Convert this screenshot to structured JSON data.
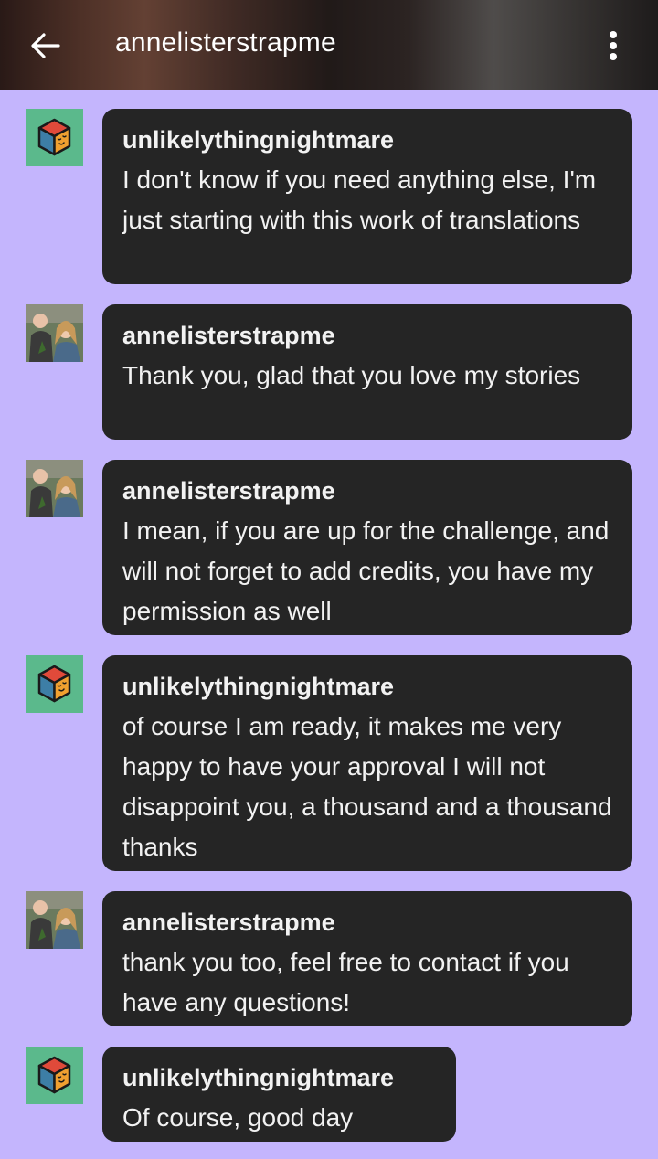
{
  "header": {
    "title": "annelisterstrapme",
    "back_icon": "arrow-left-icon",
    "menu_icon": "more-vertical-icon"
  },
  "messages": [
    {
      "sender": "unlikelythingnightmare",
      "avatar": "cube-avatar",
      "text": "I don't know if you need anything else, I'm just starting with this work of translations"
    },
    {
      "sender": "annelisterstrapme",
      "avatar": "photo-avatar",
      "text": "Thank you, glad that you love my stories"
    },
    {
      "sender": "annelisterstrapme",
      "avatar": "photo-avatar",
      "text": "I mean, if you are up for the challenge, and will not forget to add credits, you have my permission as well"
    },
    {
      "sender": "unlikelythingnightmare",
      "avatar": "cube-avatar",
      "text": "of course I am ready, it makes me very happy to have your approval I will not disappoint you, a thousand and a thousand thanks"
    },
    {
      "sender": "annelisterstrapme",
      "avatar": "photo-avatar",
      "text": "thank you too, feel free to contact if you have any questions!"
    },
    {
      "sender": "unlikelythingnightmare",
      "avatar": "cube-avatar",
      "text": "Of course, good day"
    }
  ],
  "colors": {
    "background": "#c4b5fd",
    "bubble": "#252525",
    "cube_avatar_bg": "#5bb98c",
    "cube_blue": "#3d7ea6",
    "cube_orange": "#f0a030",
    "cube_red": "#e04a3a"
  }
}
